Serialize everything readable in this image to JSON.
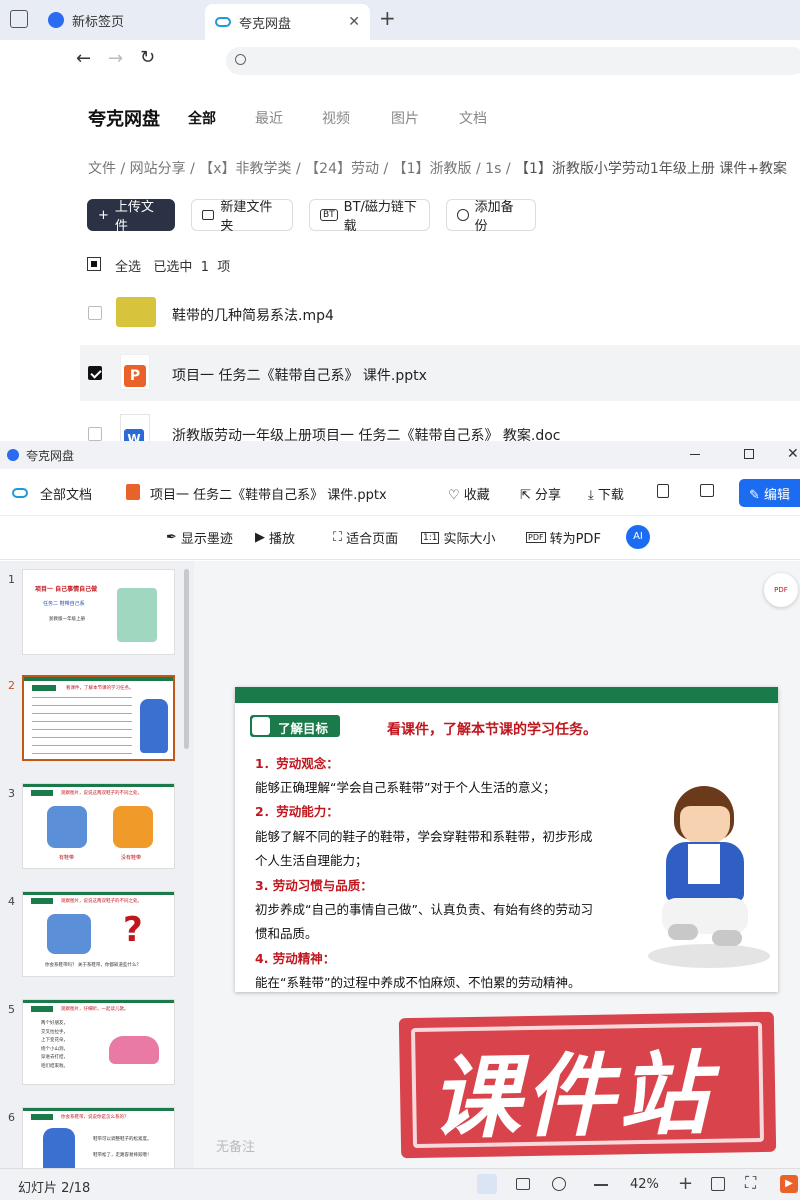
{
  "browser": {
    "tabs": [
      {
        "label": "新标签页"
      },
      {
        "label": "夸克网盘"
      }
    ],
    "new_tab_symbol": "+",
    "back_symbol": "←",
    "forward_symbol": "→",
    "reload_symbol": "↻"
  },
  "drive": {
    "brand": "夸克网盘",
    "categories": [
      "全部",
      "最近",
      "视频",
      "图片",
      "文档"
    ],
    "breadcrumb": [
      {
        "label": "文件",
        "sep": "/"
      },
      {
        "label": "网站分享",
        "sep": "/"
      },
      {
        "label": "【x】非教学类",
        "sep": "/"
      },
      {
        "label": "【24】劳动",
        "sep": "/"
      },
      {
        "label": "【1】浙教版",
        "sep": "/"
      },
      {
        "label": "1s",
        "sep": "/"
      },
      {
        "label": "【1】浙教版小学劳动1年级上册 课件+教案",
        "sep": ""
      }
    ],
    "actions": {
      "upload": "上传文件",
      "new_folder": "新建文件夹",
      "bt": "BT/磁力链下载",
      "backup": "添加备份"
    },
    "selection": {
      "select_all": "全选",
      "selected_prefix": "已选中",
      "count": "1",
      "unit": "项"
    },
    "files": [
      {
        "name": "鞋带的几种简易系法.mp4",
        "checked": false
      },
      {
        "name": "项目一 任务二《鞋带自己系》 课件.pptx",
        "checked": true
      },
      {
        "name": "浙教版劳动一年级上册项目一 任务二《鞋带自己系》 教案.doc",
        "checked": false
      }
    ]
  },
  "viewer": {
    "window_title": "夸克网盘",
    "all_docs": "全部文档",
    "file_title": "项目一 任务二《鞋带自己系》 课件.pptx",
    "actions": {
      "favorite": "收藏",
      "share": "分享",
      "download": "下载",
      "edit": "编辑"
    },
    "toolbar": {
      "ink": "显示墨迹",
      "play": "播放",
      "fit": "适合页面",
      "actual": "实际大小",
      "pdf": "转为PDF",
      "ai": "AI"
    },
    "thumb_numbers": [
      "1",
      "2",
      "3",
      "4",
      "5",
      "6"
    ],
    "notes": "无备注",
    "status": {
      "slide_indicator": "幻灯片 2/18",
      "zoom": "42%"
    },
    "watermark": "课件站",
    "accent": "#1a7a4a",
    "edit_color": "#1c6cf2"
  },
  "slide": {
    "tag": "了解目标",
    "headline": "看课件，了解本节课的学习任务。",
    "lines": [
      {
        "text": "1．劳动观念：",
        "red": true
      },
      {
        "text": "能够正确理解“学会自己系鞋带”对于个人生活的意义；",
        "red": false
      },
      {
        "text": "2．劳动能力：",
        "red": true
      },
      {
        "text": "能够了解不同的鞋子的鞋带，学会穿鞋带和系鞋带，初步形成",
        "red": false
      },
      {
        "text": "个人生活自理能力；",
        "red": false
      },
      {
        "text": "3.  劳动习惯与品质：",
        "red": true
      },
      {
        "text": "初步养成“自己的事情自己做”、认真负责、有始有终的劳动习",
        "red": false
      },
      {
        "text": "惯和品质。",
        "red": false
      },
      {
        "text": "4.  劳动精神：",
        "red": true
      },
      {
        "text": "能在“系鞋带”的过程中养成不怕麻烦、不怕累的劳动精神。",
        "red": false
      }
    ]
  },
  "thumbs": [
    {
      "title": "项目一 自己事情自己做",
      "sub": "任务二 鞋带自己系",
      "grade": "浙教版一年级上册"
    },
    {
      "header": "看课件，了解本节课的学习任务。"
    },
    {
      "header": "观察图片，说说这两双鞋子的不同之处。",
      "cap1": "有鞋带",
      "cap2": "没有鞋带"
    },
    {
      "header": "观察图片，说说这两双鞋子的不同之处。",
      "caption": "你会系鞋带吗？ 关于系鞋带，你都知道些什么？"
    },
    {
      "header": "观察图片，仔细听，一起读儿歌。",
      "rhyme": [
        "两个好朋友，",
        "交叉拉拉手，",
        "上下变花朵，",
        "绕个小山洞，",
        "穿进去打结，",
        "咱们结束啦。"
      ]
    },
    {
      "header": "你会系鞋带，说说你是怎么系的？",
      "t1": "鞋带可以调整鞋子的松紧度。",
      "t2": "鞋带松了，走路容易摔跤哦！"
    }
  ]
}
